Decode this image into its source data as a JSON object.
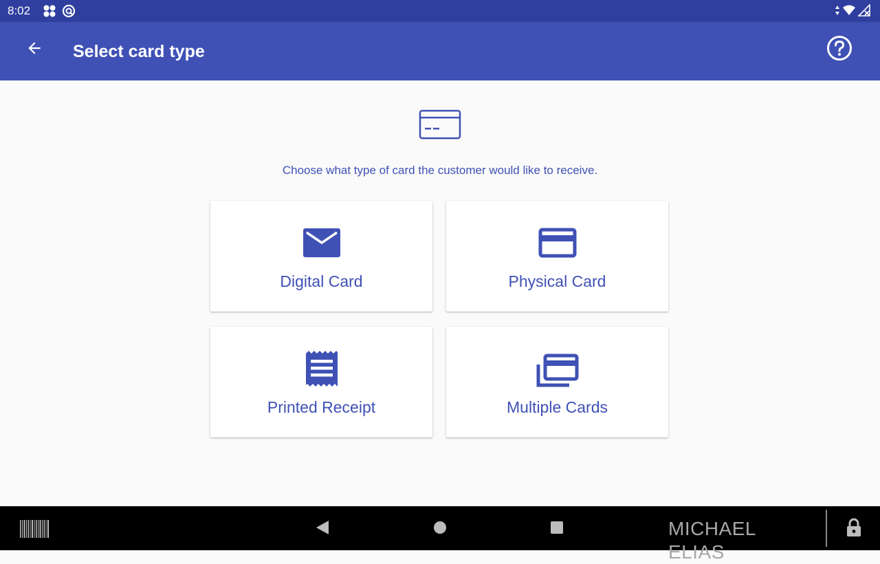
{
  "status_bar": {
    "time": "8:02",
    "left_icons": [
      "app-grid-icon",
      "sync-icon"
    ],
    "right_icons": [
      "data-arrows-icon",
      "wifi-icon",
      "signal-off-icon"
    ]
  },
  "app_bar": {
    "title": "Select card type",
    "back_icon": "arrow-left-icon",
    "help_icon": "help-circle-icon"
  },
  "main": {
    "hero_icon": "credit-card-outline-icon",
    "instruction": "Choose what type of card the customer would like to receive.",
    "options": [
      {
        "label": "Digital Card",
        "icon": "email-icon"
      },
      {
        "label": "Physical Card",
        "icon": "credit-card-icon"
      },
      {
        "label": "Printed Receipt",
        "icon": "receipt-icon"
      },
      {
        "label": "Multiple Cards",
        "icon": "multiple-cards-icon"
      }
    ]
  },
  "nav_bar": {
    "user_name": "MICHAEL ELIAS",
    "buttons": [
      "barcode-icon",
      "back-triangle-icon",
      "home-circle-icon",
      "recents-square-icon",
      "lock-icon"
    ]
  },
  "colors": {
    "primary": "#3f51b5",
    "primary_dark": "#303f9f",
    "background": "#fafafa",
    "nav_bar": "#000000"
  }
}
